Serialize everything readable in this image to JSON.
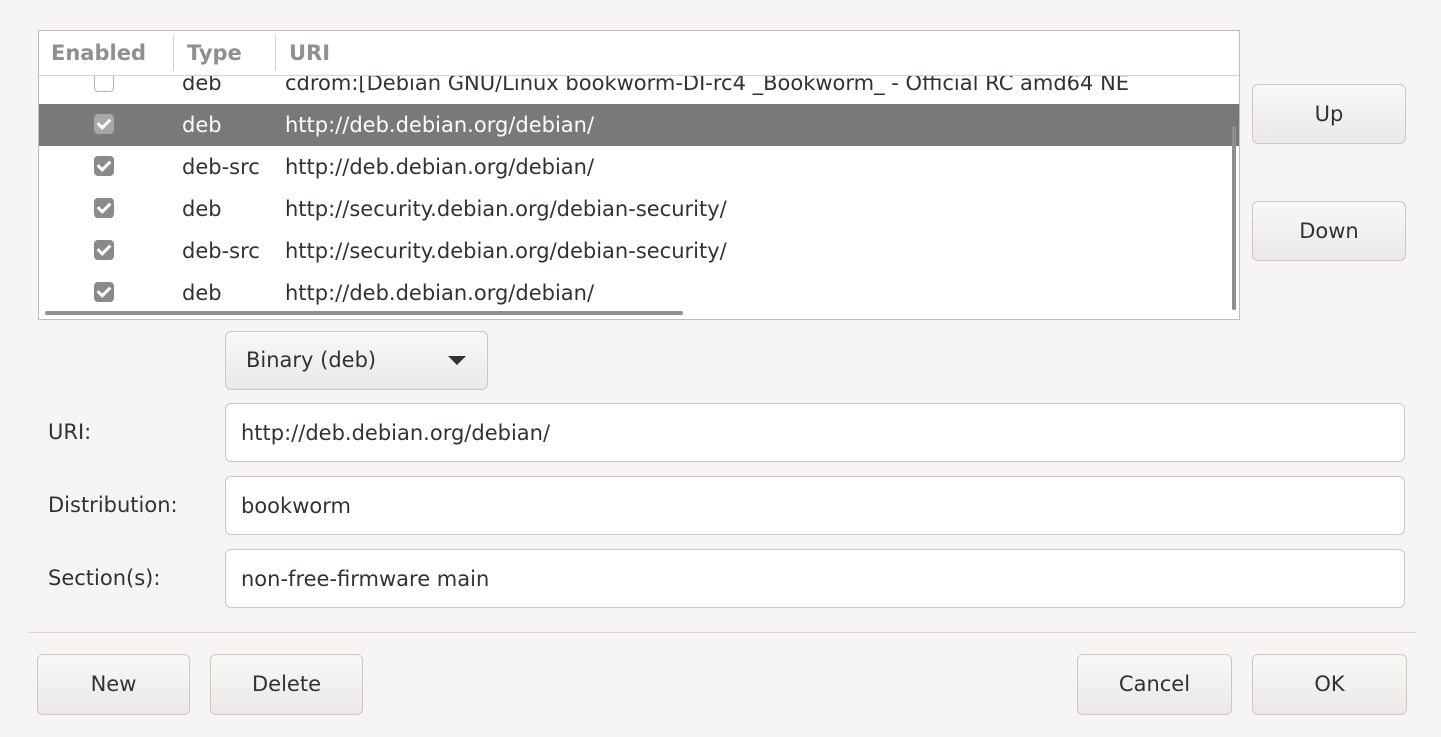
{
  "list": {
    "columns": [
      "Enabled",
      "Type",
      "URI"
    ],
    "rows": [
      {
        "enabled": false,
        "type": "deb",
        "uri": "cdrom:[Debian GNU/Linux bookworm-DI-rc4 _Bookworm_ - Official RC amd64 NE",
        "selected": false
      },
      {
        "enabled": true,
        "type": "deb",
        "uri": "http://deb.debian.org/debian/",
        "selected": true
      },
      {
        "enabled": true,
        "type": "deb-src",
        "uri": "http://deb.debian.org/debian/",
        "selected": false
      },
      {
        "enabled": true,
        "type": "deb",
        "uri": "http://security.debian.org/debian-security/",
        "selected": false
      },
      {
        "enabled": true,
        "type": "deb-src",
        "uri": "http://security.debian.org/debian-security/",
        "selected": false
      },
      {
        "enabled": true,
        "type": "deb",
        "uri": "http://deb.debian.org/debian/",
        "selected": false
      }
    ]
  },
  "side_buttons": {
    "up_label": "Up",
    "down_label": "Down"
  },
  "type_combo": {
    "value": "Binary (deb)"
  },
  "fields": {
    "uri_label": "URI:",
    "uri_value": "http://deb.debian.org/debian/",
    "distribution_label": "Distribution:",
    "distribution_value": "bookworm",
    "sections_label": "Section(s):",
    "sections_value": "non-free-firmware main"
  },
  "footer": {
    "new_label": "New",
    "delete_label": "Delete",
    "cancel_label": "Cancel",
    "ok_label": "OK"
  },
  "icons": {
    "dropdown": "chevron-down-icon",
    "check": "checkbox-checked-icon"
  }
}
